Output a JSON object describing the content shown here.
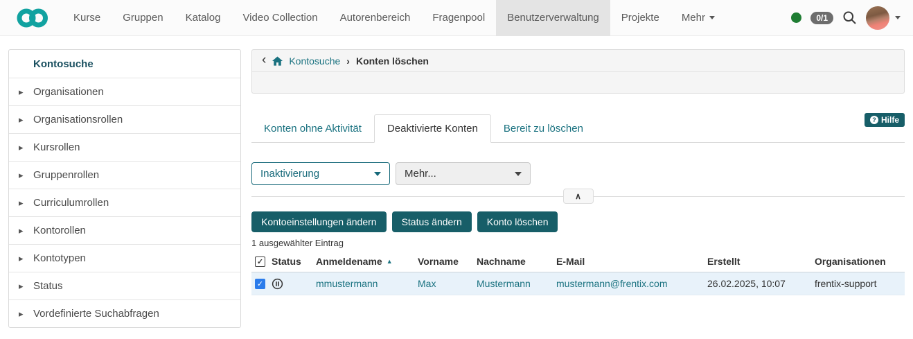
{
  "nav": {
    "items": [
      "Kurse",
      "Gruppen",
      "Katalog",
      "Video Collection",
      "Autorenbereich",
      "Fragenpool",
      "Benutzerverwaltung",
      "Projekte",
      "Mehr"
    ],
    "counter_badge": "0/1"
  },
  "sidebar": {
    "items": [
      "Kontosuche",
      "Organisationen",
      "Organisationsrollen",
      "Kursrollen",
      "Gruppenrollen",
      "Curriculumrollen",
      "Kontorollen",
      "Kontotypen",
      "Status",
      "Vordefinierte Suchabfragen"
    ]
  },
  "breadcrumb": {
    "back": "‹",
    "link": "Kontosuche",
    "separator": "›",
    "current": "Konten löschen"
  },
  "tabs": [
    "Konten ohne Aktivität",
    "Deaktivierte Konten",
    "Bereit zu löschen"
  ],
  "help_label": "Hilfe",
  "filters": {
    "primary": "Inaktivierung",
    "more": "Mehr..."
  },
  "collapse_glyph": "∧",
  "actions": [
    "Kontoeinstellungen ändern",
    "Status ändern",
    "Konto löschen"
  ],
  "selection_note": "1 ausgewählter Eintrag",
  "table": {
    "columns": [
      "Status",
      "Anmeldename",
      "Vorname",
      "Nachname",
      "E-Mail",
      "Erstellt",
      "Organisationen"
    ],
    "sort_column": "Anmeldename",
    "sort_glyph": "▲",
    "row": {
      "status": "inactive",
      "anmeldename": "mmustermann",
      "vorname": "Max",
      "nachname": "Mustermann",
      "email": "mustermann@frentix.com",
      "erstellt": "26.02.2025, 10:07",
      "organisationen": "frentix-support"
    }
  },
  "colors": {
    "accent_teal": "#1a7280",
    "button_teal": "#175e68",
    "logo_teal": "#11a2a0",
    "selected_row": "#e8f2fa",
    "checkbox_blue": "#2b7ceb",
    "online_green": "#1f7d33"
  }
}
